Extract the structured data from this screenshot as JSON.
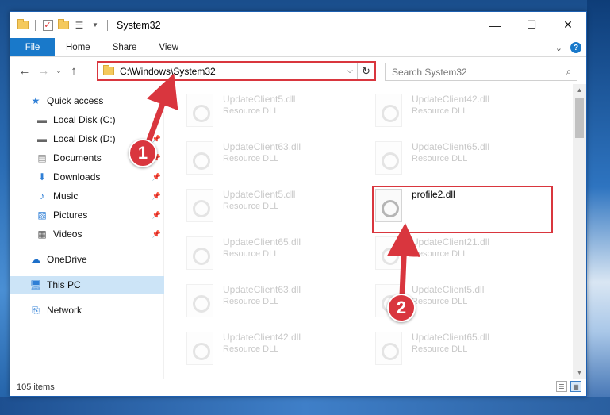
{
  "window": {
    "title": "System32",
    "controls": {
      "minimize": "—",
      "maximize": "☐",
      "close": "✕"
    }
  },
  "ribbon": {
    "tabs": [
      "File",
      "Home",
      "Share",
      "View"
    ],
    "expand_icon": "chevron-down-icon",
    "help": "?"
  },
  "address": {
    "path": "C:\\Windows\\System32",
    "dropdown": "⌵",
    "refresh": "↻"
  },
  "search": {
    "placeholder": "Search System32"
  },
  "sidebar": {
    "items": [
      {
        "label": "Quick access",
        "icon": "star-icon"
      },
      {
        "label": "Local Disk (C:)",
        "icon": "drive-icon",
        "pinned": true
      },
      {
        "label": "Local Disk (D:)",
        "icon": "drive-icon",
        "pinned": true
      },
      {
        "label": "Documents",
        "icon": "documents-icon",
        "pinned": true
      },
      {
        "label": "Downloads",
        "icon": "download-icon",
        "pinned": true
      },
      {
        "label": "Music",
        "icon": "music-icon",
        "pinned": true
      },
      {
        "label": "Pictures",
        "icon": "pictures-icon",
        "pinned": true
      },
      {
        "label": "Videos",
        "icon": "videos-icon",
        "pinned": true
      },
      {
        "label": "OneDrive",
        "icon": "cloud-icon"
      },
      {
        "label": "This PC",
        "icon": "computer-icon",
        "selected": true
      },
      {
        "label": "Network",
        "icon": "network-icon"
      }
    ]
  },
  "files": {
    "col1": [
      {
        "name": "UpdateClient5.dll",
        "type": "Resource DLL"
      },
      {
        "name": "UpdateClient63.dll",
        "type": "Resource DLL"
      },
      {
        "name": "UpdateClient5.dll",
        "type": "Resource DLL"
      },
      {
        "name": "UpdateClient65.dll",
        "type": "Resource DLL"
      },
      {
        "name": "UpdateClient63.dll",
        "type": "Resource DLL"
      },
      {
        "name": "UpdateClient42.dll",
        "type": "Resource DLL"
      }
    ],
    "col2": [
      {
        "name": "UpdateClient42.dll",
        "type": "Resource DLL"
      },
      {
        "name": "UpdateClient65.dll",
        "type": "Resource DLL"
      },
      {
        "name": "profile2.dll",
        "type": ""
      },
      {
        "name": "UpdateClient21.dll",
        "type": "Resource DLL"
      },
      {
        "name": "UpdateClient5.dll",
        "type": "Resource DLL"
      },
      {
        "name": "UpdateClient65.dll",
        "type": "Resource DLL"
      }
    ]
  },
  "status": {
    "count": "105 items"
  },
  "annotations": {
    "badge1": "1",
    "badge2": "2",
    "color": "#d9363e"
  }
}
